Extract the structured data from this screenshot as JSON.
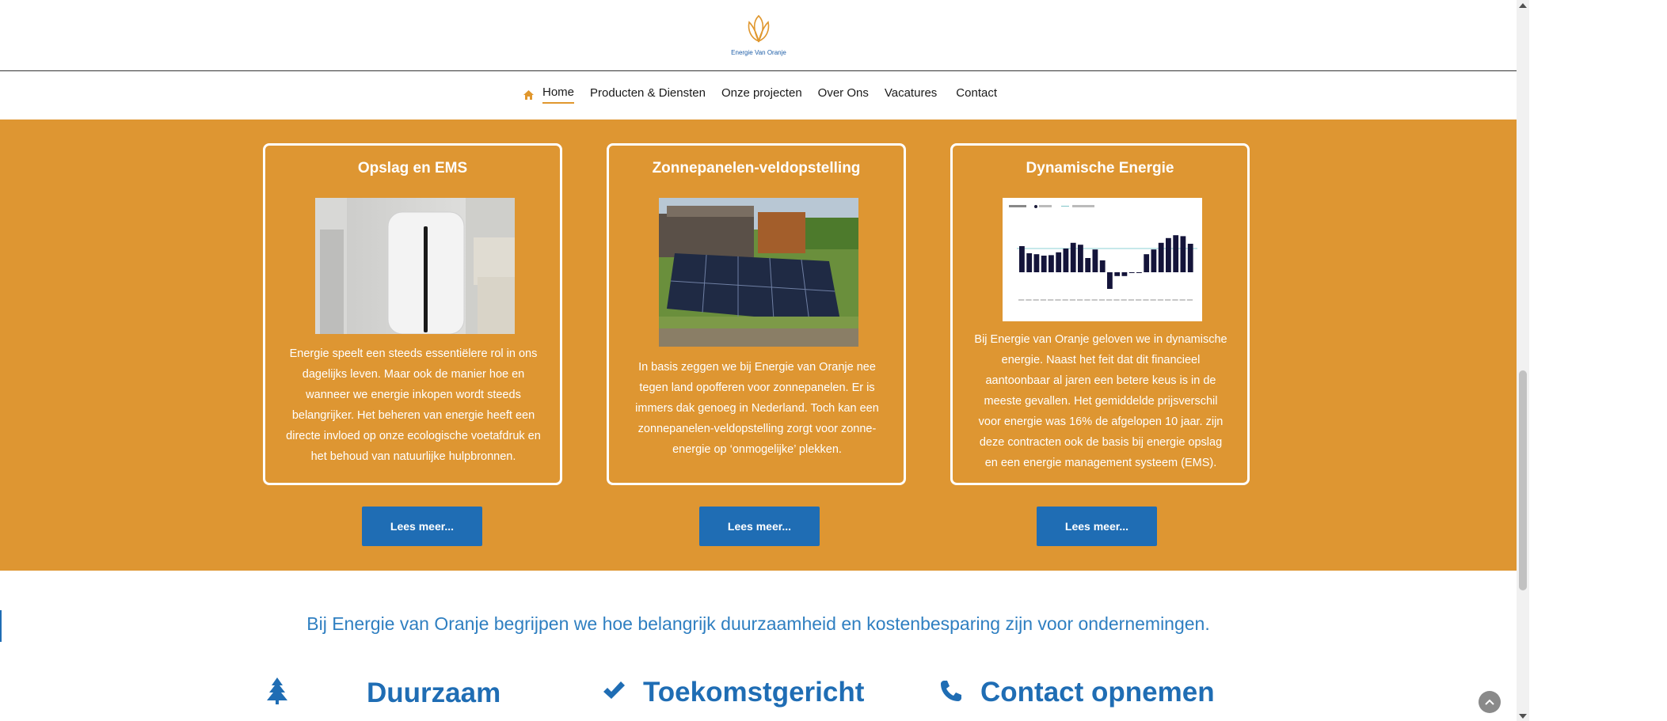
{
  "brand": {
    "logo_text": "Energie Van Oranje"
  },
  "nav": {
    "items": [
      {
        "label": "Home",
        "active": true
      },
      {
        "label": "Producten & Diensten"
      },
      {
        "label": "Onze projecten"
      },
      {
        "label": "Over Ons"
      },
      {
        "label": "Vacatures"
      },
      {
        "label": "Contact"
      }
    ]
  },
  "cards": [
    {
      "title": "Opslag en EMS",
      "text": "Energie speelt een steeds essentiëlere rol in ons dagelijks leven. Maar ook de manier hoe en wanneer we energie inkopen wordt steeds belangrijker. Het beheren van energie heeft een directe invloed op onze ecologische voetafdruk en het behoud van natuurlijke hulpbronnen.",
      "button": "Lees meer..."
    },
    {
      "title": "Zonnepanelen-veldopstelling",
      "text": "In basis zeggen we bij Energie van Oranje nee tegen land opofferen voor zonnepanelen. Er is immers dak genoeg in Nederland. Toch kan een zonnepanelen-veldopstelling zorgt voor zonne-energie op ‘onmogelijke’ plekken.",
      "button": "Lees meer..."
    },
    {
      "title": "Dynamische Energie",
      "text": "Bij Energie van Oranje geloven we in dynamische energie. Naast het feit dat dit financieel aantoonbaar al jaren een betere keus is in de meeste gevallen. Het gemiddelde prijsverschil voor energie was 16% de afgelopen 10 jaar. zijn deze contracten ook de basis bij energie opslag en een energie management systeem (EMS).",
      "button": "Lees meer...",
      "thumb_chart_values": [
        0.55,
        0.4,
        0.38,
        0.35,
        0.36,
        0.42,
        0.5,
        0.62,
        0.58,
        0.3,
        0.48,
        0.25,
        -0.35,
        -0.08,
        -0.08,
        0.0,
        0.0,
        0.38,
        0.48,
        0.62,
        0.72,
        0.78,
        0.76,
        0.6
      ]
    }
  ],
  "tagline": "Bij Energie van Oranje begrijpen we hoe belangrijk duurzaamheid en kostenbesparing zijn voor ondernemingen.",
  "features": [
    {
      "title": "Duurzaam",
      "icon": "tree-icon"
    },
    {
      "title": "Toekomstgericht",
      "icon": "check-icon"
    },
    {
      "title": "Contact opnemen",
      "icon": "phone-icon"
    }
  ],
  "colors": {
    "accent": "#de9632",
    "primary": "#1f6db4",
    "tagline": "#2f7fc1"
  }
}
